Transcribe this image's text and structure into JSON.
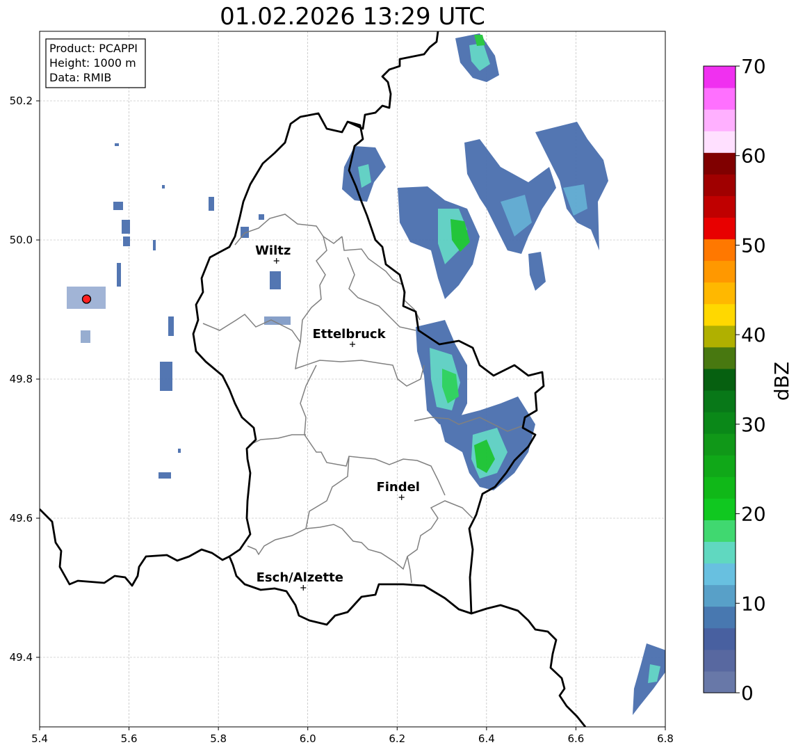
{
  "title": "01.02.2026 13:29 UTC",
  "info": {
    "product": "Product: PCAPPI",
    "height": "Height: 1000 m",
    "data": "Data: RMIB"
  },
  "axes": {
    "x_ticks": [
      "5.4",
      "5.6",
      "5.8",
      "6.0",
      "6.2",
      "6.4",
      "6.6",
      "6.8"
    ],
    "y_ticks": [
      "49.4",
      "49.6",
      "49.8",
      "50.0",
      "50.2"
    ],
    "xlim": [
      5.4,
      6.8
    ],
    "ylim": [
      49.3,
      50.3
    ],
    "grid": true
  },
  "colorbar": {
    "label": "dBZ",
    "ticks": [
      "0",
      "10",
      "20",
      "30",
      "40",
      "50",
      "60",
      "70"
    ],
    "range": [
      0,
      70
    ],
    "colors": [
      "#6878a8",
      "#5868a0",
      "#4860a0",
      "#4878b0",
      "#58a0c8",
      "#68c0e0",
      "#60d8c0",
      "#40d870",
      "#10c820",
      "#10b818",
      "#10a818",
      "#109818",
      "#0a8818",
      "#087818",
      "#066010",
      "#487810",
      "#b0b000",
      "#ffd800",
      "#ffb800",
      "#ff9800",
      "#ff7800",
      "#e80000",
      "#c00000",
      "#a00000",
      "#800000",
      "#ffe0ff",
      "#ffb0ff",
      "#ff70ff",
      "#f030f0"
    ]
  },
  "cities": [
    {
      "name": "Wiltz",
      "lon": 5.93,
      "lat": 49.97
    },
    {
      "name": "Ettelbruck",
      "lon": 6.1,
      "lat": 49.85
    },
    {
      "name": "Findel",
      "lon": 6.21,
      "lat": 49.63
    },
    {
      "name": "Esch/Alzette",
      "lon": 5.99,
      "lat": 49.5
    }
  ],
  "radar_site": {
    "lon": 5.505,
    "lat": 49.915,
    "color": "#ff2020"
  },
  "colors": {
    "border": "#000000",
    "canton": "#808080",
    "grid": "#b0b0b0",
    "echo_low": "#4878b0",
    "echo_mid": "#60d8c0",
    "echo_high": "#10c820"
  }
}
